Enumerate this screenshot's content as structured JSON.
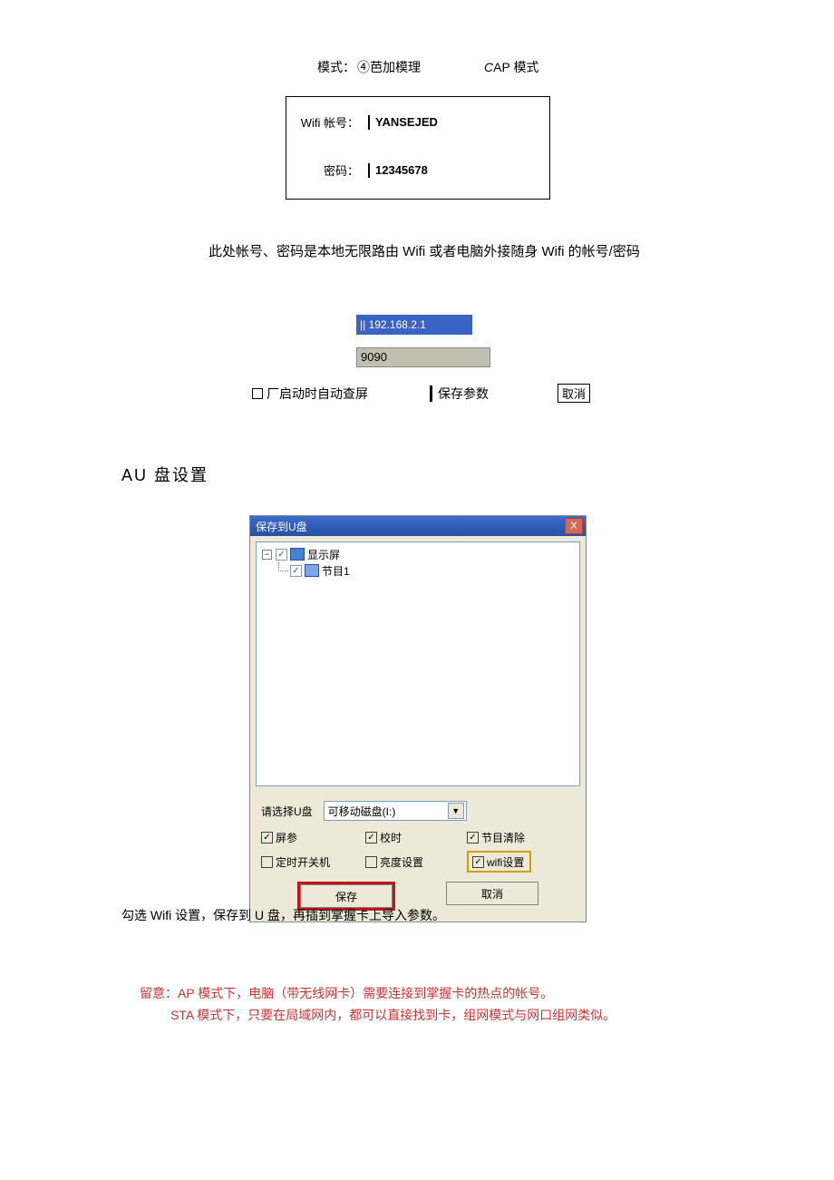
{
  "mode": {
    "label": "模式：",
    "opt1": "④芭加模理",
    "opt2_prefix": "C",
    "opt2_suffix": "AP 模式"
  },
  "form": {
    "account_label": "Wifi 帐号：",
    "account_value": "YANSEJED",
    "pwd_label": "密码：",
    "pwd_value": "12345678"
  },
  "desc_line": "此处帐号、密码是本地无限路由 Wifi 或者电脑外接随身 Wifi 的帐号/密码",
  "net": {
    "ip": "|| 192.168.2.1",
    "port": "9090"
  },
  "btnrow": {
    "auto": "厂启动时自动查屏",
    "save": "保存参数",
    "cancel": "取消"
  },
  "section": "AU 盘设置",
  "dialog": {
    "title": "保存到U盘",
    "close": "X",
    "tree_root": "显示屏",
    "tree_child": "节目1",
    "select_label": "请选择U盘",
    "drive": "可移动磁盘(I:)",
    "row1": {
      "c1": "屏参",
      "c2": "校时",
      "c3": "节目清除"
    },
    "row2": {
      "c1": "定时开关机",
      "c2": "亮度设置",
      "c3": "wifi设置"
    },
    "save_btn": "保存",
    "cancel_btn": "取消"
  },
  "caption": "勾选 Wifi 设置，保存到 U 盘，再插到掌握卡上导入参数。",
  "notes": {
    "line1": "留意：AP 模式下，电脑（带无线网卡）需要连接到掌握卡的热点的帐号。",
    "line2": "STA 模式下，只要在局域网内，都可以直接找到卡，组网模式与网口组网类似。"
  }
}
